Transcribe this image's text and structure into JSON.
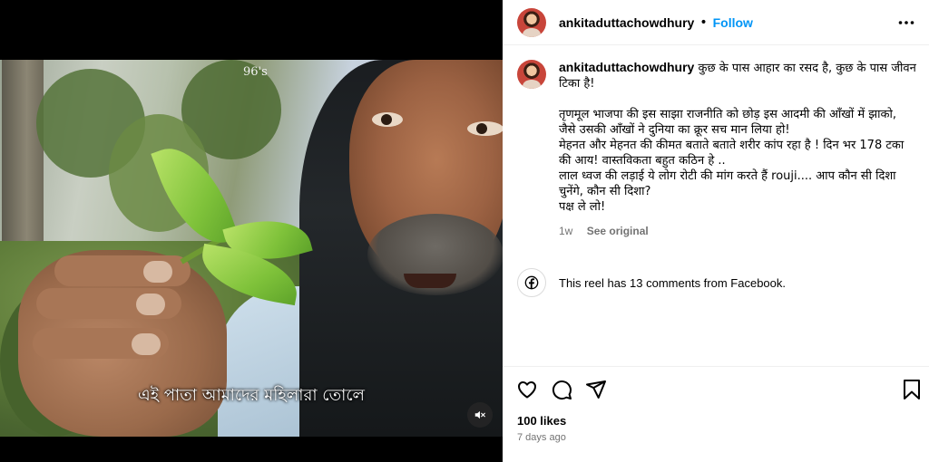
{
  "video": {
    "watermark": "96's",
    "subtitle": "এই পাতা আমাদের মহিলারা তোলে",
    "mute_icon": "speaker-muted-icon"
  },
  "header": {
    "username": "ankitaduttachowdhury",
    "separator": "•",
    "follow_label": "Follow",
    "more_icon": "more-horizontal-icon"
  },
  "caption": {
    "username": "ankitaduttachowdhury",
    "lines": [
      "कुछ के पास आहार का रसद है, कुछ के पास जीवन टिका है!",
      "",
      "तृणमूल भाजपा की इस साझा राजनीति को छोड़ इस आदमी की आँखों में झाको,",
      "जैसे उसकी आँखों ने दुनिया का क्रूर सच मान लिया हो!",
      "मेहनत और मेहनत की कीमत बताते बताते शरीर कांप रहा है ! दिन भर 178 टका की आय! वास्तविकता बहुत कठिन हे ..",
      "लाल ध्वज की लड़ाई ये लोग रोटी की मांग करते हैं rouji.... आप कौन सी दिशा चुनेंगे, कौन सी दिशा?",
      "पक्ष ले लो!"
    ],
    "age": "1w",
    "see_original": "See original"
  },
  "facebook": {
    "icon": "facebook-icon",
    "text": "This reel has 13 comments from Facebook."
  },
  "actions": {
    "like_icon": "heart-icon",
    "comment_icon": "comment-icon",
    "share_icon": "share-icon",
    "save_icon": "bookmark-icon"
  },
  "stats": {
    "likes": "100 likes",
    "date": "7 days ago"
  },
  "colors": {
    "accent": "#0095f6",
    "muted_text": "#737373"
  }
}
